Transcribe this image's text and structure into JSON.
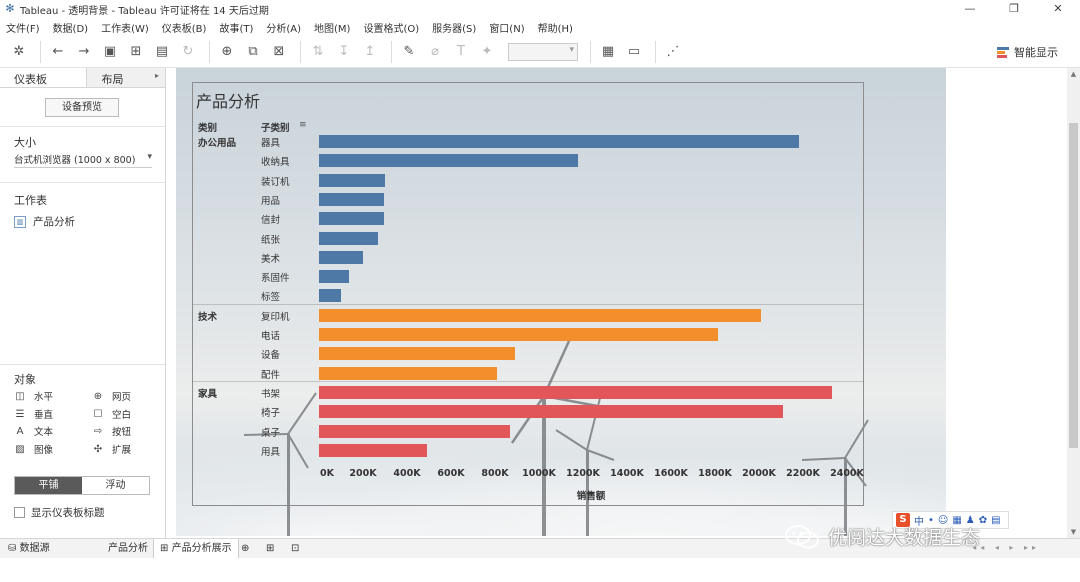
{
  "window": {
    "title": "Tableau - 透明背景 - Tableau 许可证将在 14 天后过期",
    "controls": [
      "—",
      "❐",
      "✕"
    ]
  },
  "menu": [
    "文件(F)",
    "数据(D)",
    "工作表(W)",
    "仪表板(B)",
    "故事(T)",
    "分析(A)",
    "地图(M)",
    "设置格式(O)",
    "服务器(S)",
    "窗口(N)",
    "帮助(H)"
  ],
  "toolbar": {
    "smart_label": "智能显示"
  },
  "left_panel": {
    "tab_dashboard": "仪表板",
    "tab_layout": "布局",
    "preview_button": "设备预览",
    "size_title": "大小",
    "size_value": "台式机浏览器 (1000 x 800)",
    "sheets_title": "工作表",
    "sheet_name": "产品分析",
    "objects_title": "对象",
    "objects": {
      "horizontal": "水平",
      "webpage": "网页",
      "vertical": "垂直",
      "blank": "空白",
      "text": "文本",
      "button": "按钮",
      "image": "图像",
      "extension": "扩展"
    },
    "tiled": "平铺",
    "floating": "浮动",
    "show_title": "显示仪表板标题"
  },
  "dashboard": {
    "title": "产品分析",
    "col_category": "类别",
    "col_subcategory": "子类别",
    "colors": {
      "office": "#4e79a7",
      "tech": "#f28e2b",
      "furniture": "#e15759"
    }
  },
  "chart_data": {
    "type": "bar",
    "orientation": "horizontal",
    "title": "产品分析",
    "xlabel": "销售额",
    "xlim": [
      0,
      2400000
    ],
    "x_ticks": [
      "0K",
      "200K",
      "400K",
      "600K",
      "800K",
      "1000K",
      "1200K",
      "1400K",
      "1600K",
      "1800K",
      "2000K",
      "2200K",
      "2400K"
    ],
    "groups": [
      {
        "category": "办公用品",
        "color": "#4e79a7",
        "items": [
          {
            "name": "器具",
            "value": 2180000
          },
          {
            "name": "收纳具",
            "value": 1175000
          },
          {
            "name": "装订机",
            "value": 300000
          },
          {
            "name": "用品",
            "value": 295000
          },
          {
            "name": "信封",
            "value": 295000
          },
          {
            "name": "纸张",
            "value": 270000
          },
          {
            "name": "美术",
            "value": 200000
          },
          {
            "name": "系固件",
            "value": 135000
          },
          {
            "name": "标签",
            "value": 100000
          }
        ]
      },
      {
        "category": "技术",
        "color": "#f28e2b",
        "items": [
          {
            "name": "复印机",
            "value": 2010000
          },
          {
            "name": "电话",
            "value": 1815000
          },
          {
            "name": "设备",
            "value": 890000
          },
          {
            "name": "配件",
            "value": 810000
          }
        ]
      },
      {
        "category": "家具",
        "color": "#e15759",
        "items": [
          {
            "name": "书架",
            "value": 2330000
          },
          {
            "name": "椅子",
            "value": 2110000
          },
          {
            "name": "桌子",
            "value": 870000
          },
          {
            "name": "用具",
            "value": 490000
          }
        ]
      }
    ]
  },
  "bottom_tabs": {
    "datasource": "数据源",
    "sheet": "产品分析",
    "dashboard": "产品分析展示"
  },
  "watermark": {
    "text": "优阅达大数据生态",
    "ime_label": "中"
  }
}
